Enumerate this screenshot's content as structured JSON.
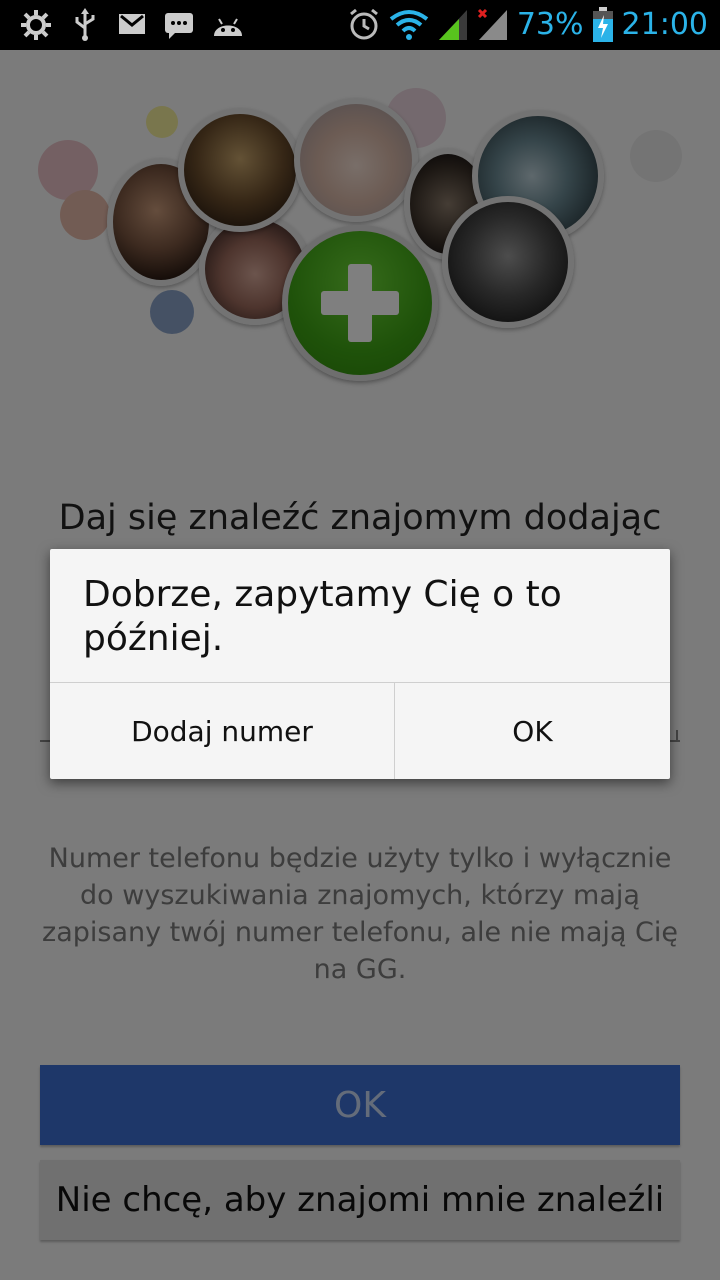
{
  "status_bar": {
    "battery": "73%",
    "time": "21:00",
    "icons": [
      "settings-icon",
      "usb-icon",
      "gmail-icon",
      "message-icon",
      "android-icon",
      "alarm-icon",
      "wifi-icon",
      "signal-icon",
      "signal-no-data-icon",
      "battery-charging-icon"
    ]
  },
  "screen": {
    "headline": "Daj się znaleźć znajomym dodając",
    "info_text": "Numer telefonu będzie użyty tylko i wyłącznie do wyszukiwania znajomych, którzy mają zapisany twój numer telefonu, ale nie mają Cię na GG.",
    "ok_label": "OK",
    "decline_label": "Nie chcę, aby znajomi mnie znaleźli",
    "colors": {
      "primary_button": "#3c6fd3",
      "accent_green": "#3ea414"
    }
  },
  "dialog": {
    "message": "Dobrze, zapytamy Cię o to później.",
    "add_number_label": "Dodaj numer",
    "ok_label": "OK"
  }
}
